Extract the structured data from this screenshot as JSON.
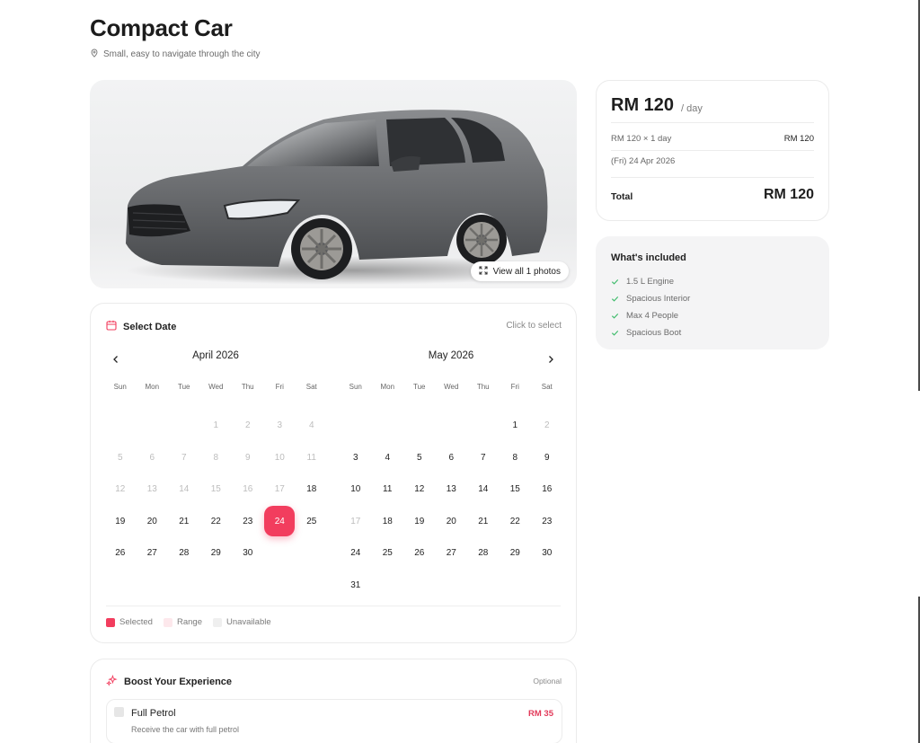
{
  "header": {
    "title": "Compact Car",
    "subtitle": "Small, easy to navigate through the city"
  },
  "gallery": {
    "view_all_label": "View all 1 photos"
  },
  "calendar": {
    "title": "Select Date",
    "hint": "Click to select",
    "weekdays": [
      "Sun",
      "Mon",
      "Tue",
      "Wed",
      "Thu",
      "Fri",
      "Sat"
    ],
    "months": [
      {
        "label": "April 2026",
        "leading_blanks": 3,
        "days": [
          "1",
          "2",
          "3",
          "4",
          "5",
          "6",
          "7",
          "8",
          "9",
          "10",
          "11",
          "12",
          "13",
          "14",
          "15",
          "16",
          "17",
          "18",
          "19",
          "20",
          "21",
          "22",
          "23",
          "24",
          "25",
          "26",
          "27",
          "28",
          "29",
          "30"
        ],
        "unavailable": [
          "1",
          "2",
          "3",
          "4",
          "5",
          "6",
          "7",
          "8",
          "9",
          "10",
          "11",
          "12",
          "13",
          "14",
          "15",
          "16",
          "17"
        ],
        "selected": "24"
      },
      {
        "label": "May 2026",
        "leading_blanks": 5,
        "days": [
          "1",
          "2",
          "3",
          "4",
          "5",
          "6",
          "7",
          "8",
          "9",
          "10",
          "11",
          "12",
          "13",
          "14",
          "15",
          "16",
          "17",
          "18",
          "19",
          "20",
          "21",
          "22",
          "23",
          "24",
          "25",
          "26",
          "27",
          "28",
          "29",
          "30",
          "31"
        ],
        "unavailable": [
          "2",
          "17"
        ],
        "selected": ""
      }
    ],
    "legend": {
      "selected": "Selected",
      "range": "Range",
      "unavailable": "Unavailable"
    }
  },
  "boost": {
    "title": "Boost Your Experience",
    "optional_label": "Optional",
    "items": [
      {
        "title": "Full Petrol",
        "description": "Receive the car with full petrol",
        "price": "RM 35"
      }
    ]
  },
  "pricing": {
    "price": "RM 120",
    "unit": "/ day",
    "breakdown_label": "RM 120 × 1 day",
    "breakdown_value": "RM 120",
    "date_label": "(Fri) 24 Apr 2026",
    "total_label": "Total",
    "total_value": "RM 120"
  },
  "included": {
    "title": "What's included",
    "items": [
      "1.5 L Engine",
      "Spacious Interior",
      "Max 4 People",
      "Spacious Boot"
    ]
  },
  "colors": {
    "accent": "#f23d5e",
    "range": "#fde8ec",
    "unavailable": "#efefef",
    "check": "#3dbb6a"
  }
}
